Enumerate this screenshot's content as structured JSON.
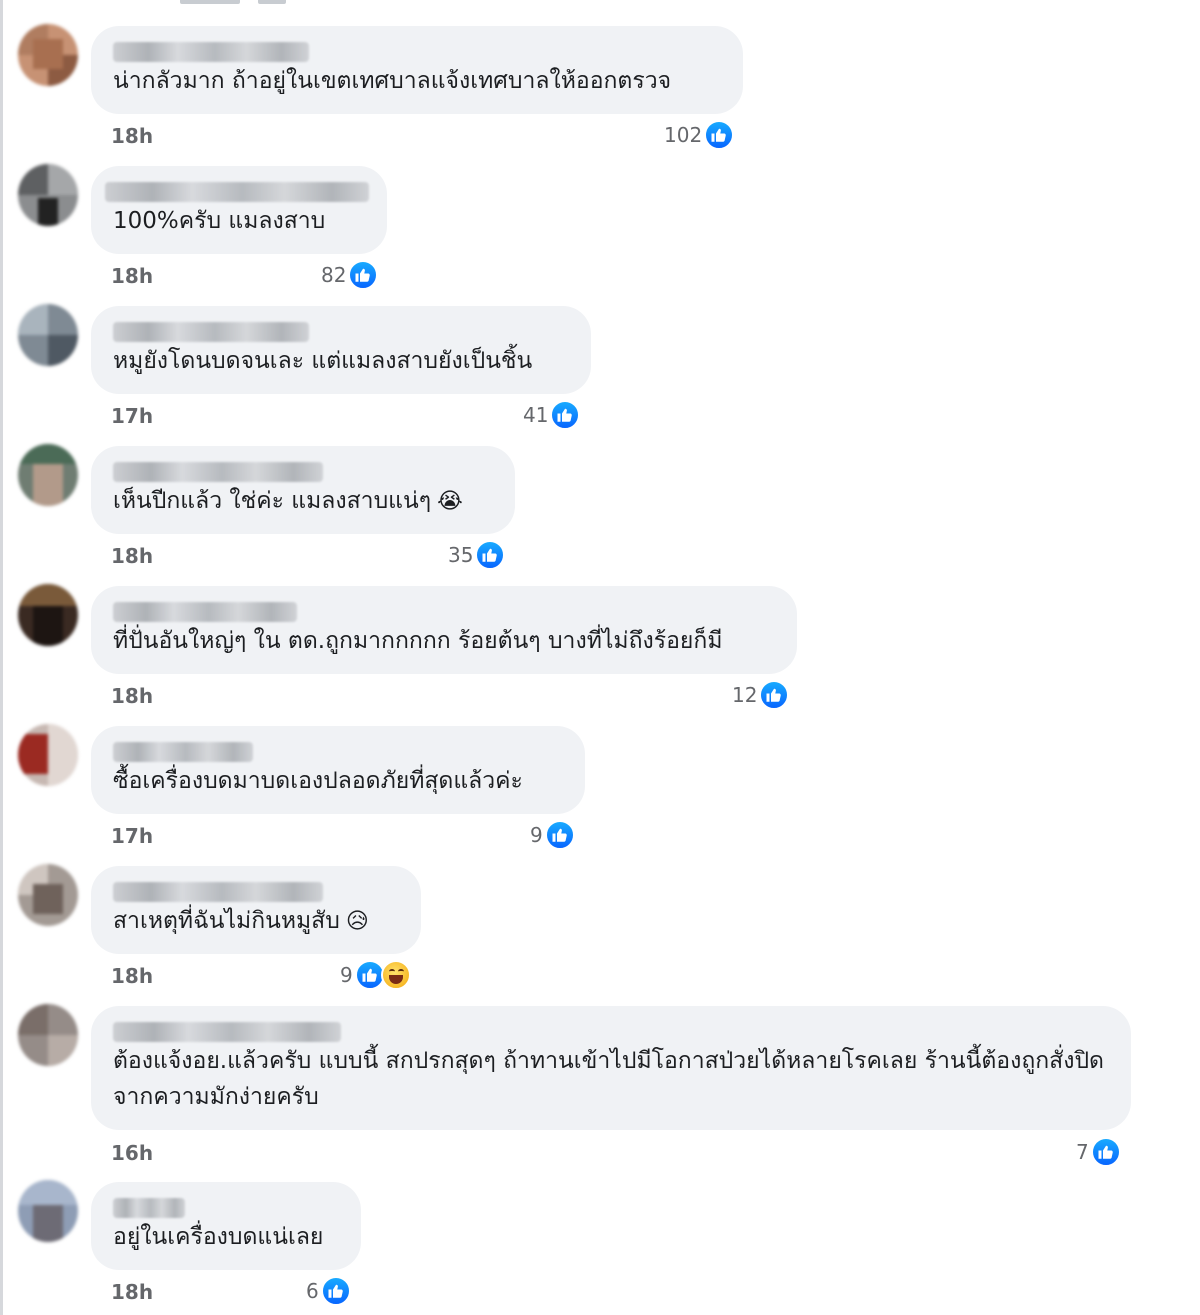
{
  "comments": [
    {
      "text": "น่ากลัวมาก ถ้าอยู่ในเขตเทศบาลแจ้งเทศบาลให้ออกตรวจ",
      "time": "18h",
      "likes": "102"
    },
    {
      "text": "100%ครับ แมลงสาบ",
      "time": "18h",
      "likes": "82"
    },
    {
      "text": "หมูยังโดนบดจนเละ แต่แมลงสาบยังเป็นชิ้น",
      "time": "17h",
      "likes": "41"
    },
    {
      "text": "เห็นปีกแล้ว ใช่ค่ะ แมลงสาบแน่ๆ",
      "emoji": "😭",
      "time": "18h",
      "likes": "35"
    },
    {
      "text": "ที่ปั่นอันใหญ่ๆ ใน ตด.ถูกมากกกกก ร้อยต้นๆ บางที่ไม่ถึงร้อยก็มี",
      "time": "18h",
      "likes": "12"
    },
    {
      "text": "ซื้อเครื่องบดมาบดเองปลอดภัยที่สุดแล้วค่ะ",
      "time": "17h",
      "likes": "9"
    },
    {
      "text": "สาเหตุที่ฉันไม่กินหมูสับ",
      "emoji": "😥",
      "time": "18h",
      "likes": "9",
      "reactions": [
        "like-icon",
        "haha-icon"
      ]
    },
    {
      "text": "ต้องแจ้งอย.แล้วครับ แบบนี้ สกปรกสุดๆ ถ้าทานเข้าไปมีโอกาสป่วยได้หลายโรคเลย ร้านนี้ต้องถูกสั่งปิดจากความมักง่ายครับ",
      "time": "16h",
      "likes": "7"
    },
    {
      "text": "อยู่ในเครื่องบดแน่เลย",
      "time": "18h",
      "likes": "6"
    }
  ],
  "colors": {
    "bubble": "#f0f2f5",
    "like_blue": "#0866ff",
    "meta_gray": "#65676b"
  }
}
